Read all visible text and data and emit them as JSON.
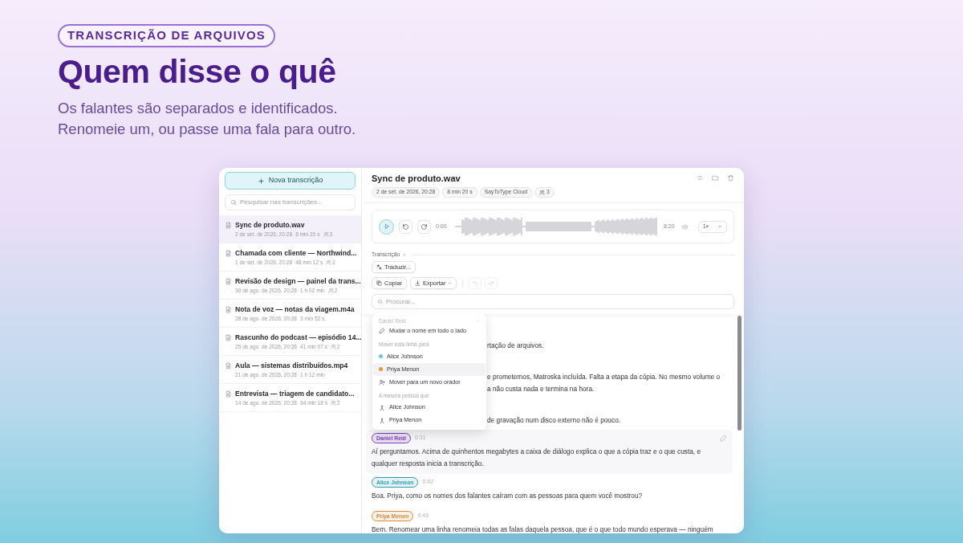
{
  "hero": {
    "eyebrow": "TRANSCRIÇÃO DE ARQUIVOS",
    "title": "Quem disse o quê",
    "subtitle": [
      "Os falantes são separados e identificados.",
      "Renomeie um, ou passe uma fala para outro."
    ]
  },
  "sidebar": {
    "new_button": "Nova transcrição",
    "search": {
      "placeholder": "Pesquisar nas transcrições..."
    },
    "items": [
      {
        "title": "Sync de produto.wav",
        "date": "2 de set. de 2026, 20:28",
        "duration": "8 min 20 s",
        "speakers": "3",
        "selected": true
      },
      {
        "title": "Chamada com cliente — Northwind...",
        "date": "1 de set. de 2026, 20:28",
        "duration": "48 min 12 s",
        "speakers": "2",
        "selected": false
      },
      {
        "title": "Revisão de design — painel da trans...",
        "date": "30 de ago. de 2026, 20:28",
        "duration": "1 h 02 min",
        "speakers": "2",
        "selected": false
      },
      {
        "title": "Nota de voz — notas da viagem.m4a",
        "date": "28 de ago. de 2026, 20:28",
        "duration": "3 min 52 s",
        "selected": false
      },
      {
        "title": "Rascunho do podcast — episódio 14...",
        "date": "25 de ago. de 2026, 20:28",
        "duration": "41 min 07 s",
        "speakers": "2",
        "selected": false
      },
      {
        "title": "Aula — sistemas distribuídos.mp4",
        "date": "21 de ago. de 2026, 20:28",
        "duration": "1 h 12 min",
        "selected": false
      },
      {
        "title": "Entrevista — triagem de candidato...",
        "date": "14 de ago. de 2026, 20:28",
        "duration": "34 min 18 s",
        "speakers": "2",
        "selected": false
      }
    ]
  },
  "file": {
    "title": "Sync de produto.wav",
    "chips": [
      "2 de set. de 2026, 20:28",
      "8 min 20 s",
      "SayToType Cloud"
    ],
    "speakers": "3"
  },
  "player": {
    "current": "0:00",
    "total": "8:20",
    "speed": "1×"
  },
  "transcript_section": {
    "label": "Transcrição",
    "expanded": true,
    "translate": "Traduzir...",
    "copy": "Copiar",
    "export": "Exportar",
    "undo_disabled": true,
    "redo_disabled": true,
    "search": {
      "placeholder": "Procurar..."
    }
  },
  "segments": [
    {
      "kind": "partial",
      "lines": [
        "rtação de arquivos."
      ]
    },
    {
      "kind": "partial",
      "lines": [
        "e prometemos, Matroska incluída. Falta a etapa da cópia. No mesmo volume o",
        "a não custa nada e termina na hora."
      ]
    },
    {
      "kind": "partial",
      "lines": [
        "de gravação num disco externo não é pouco."
      ]
    },
    {
      "kind": "full",
      "speaker": "Daniel Reid",
      "color": "#7e3fc0",
      "time": "0:31",
      "highlighted": true,
      "text": "Aí perguntamos. Acima de quinhentos megabytes a caixa de diálogo explica o que a cópia traz e o que custa, e qualquer resposta inicia a transcrição."
    },
    {
      "kind": "full",
      "speaker": "Alice Johnson",
      "color": "#2b9db0",
      "time": "0:42",
      "highlighted": false,
      "text": "Boa. Priya, como os nomes dos falantes caíram com as pessoas para quem você mostrou?"
    },
    {
      "kind": "full",
      "speaker": "Priya Menon",
      "color": "#d98a3a",
      "time": "0:49",
      "highlighted": false,
      "text": "Bem. Renomear uma linha renomeia todas as falas daquela pessoa, que é o que todo mundo esperava — ninguém"
    }
  ],
  "menu": {
    "header": "Daniel Reid",
    "items": [
      {
        "kind": "rename",
        "label": "Mudar o nome em todo o lado"
      },
      {
        "kind": "section",
        "label": "Mover esta linha para"
      },
      {
        "kind": "speaker",
        "label": "Alice Johnson",
        "color": "#6ec6e6",
        "selected": false
      },
      {
        "kind": "speaker",
        "label": "Priya Menon",
        "color": "#e8953a",
        "selected": true
      },
      {
        "kind": "new-speaker",
        "label": "Mover para um novo orador"
      },
      {
        "kind": "section",
        "label": "A mesma pessoa que"
      },
      {
        "kind": "merge",
        "label": "Alice Johnson"
      },
      {
        "kind": "merge",
        "label": "Priya Menon"
      }
    ]
  }
}
